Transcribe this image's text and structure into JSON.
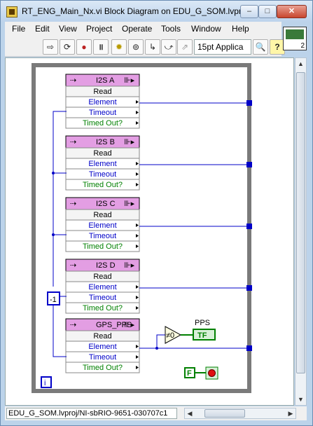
{
  "window": {
    "title": "RT_ENG_Main_Nx.vi Block Diagram on EDU_G_SOM.lvpr...",
    "min_symbol": "–",
    "max_symbol": "□",
    "close_symbol": "✕"
  },
  "menu": [
    "File",
    "Edit",
    "View",
    "Project",
    "Operate",
    "Tools",
    "Window",
    "Help"
  ],
  "toolbar": {
    "font": "15pt Applica",
    "icons": [
      "run-arrow",
      "run-continuous",
      "abort",
      "pause",
      "highlight-bulb",
      "retain-wire",
      "step-into",
      "step-over",
      "step-out",
      "font-select",
      "search",
      "help"
    ]
  },
  "vi_icon": {
    "number": "2"
  },
  "nodes": [
    {
      "name": "I2S A",
      "rows": [
        "Read",
        "Element",
        "Timeout",
        "Timed Out?"
      ]
    },
    {
      "name": "I2S B",
      "rows": [
        "Read",
        "Element",
        "Timeout",
        "Timed Out?"
      ]
    },
    {
      "name": "I2S C",
      "rows": [
        "Read",
        "Element",
        "Timeout",
        "Timed Out?"
      ]
    },
    {
      "name": "I2S D",
      "rows": [
        "Read",
        "Element",
        "Timeout",
        "Timed Out?"
      ]
    },
    {
      "name": "GPS_PPS",
      "rows": [
        "Read",
        "Element",
        "Timeout",
        "Timed Out?"
      ]
    }
  ],
  "constant_value": "-1",
  "compare_label": "≠0",
  "pps": {
    "label": "PPS",
    "indicator": "TF"
  },
  "false_constant": "F",
  "loop_iteration": "i",
  "colors": {
    "node_header": "#e39ee3",
    "wire_blue": "#0000c8",
    "wire_green": "#008000",
    "loop_border": "#7a7a7a"
  },
  "status": {
    "path": "EDU_G_SOM.lvproj/NI-sbRIO-9651-030707c1"
  }
}
